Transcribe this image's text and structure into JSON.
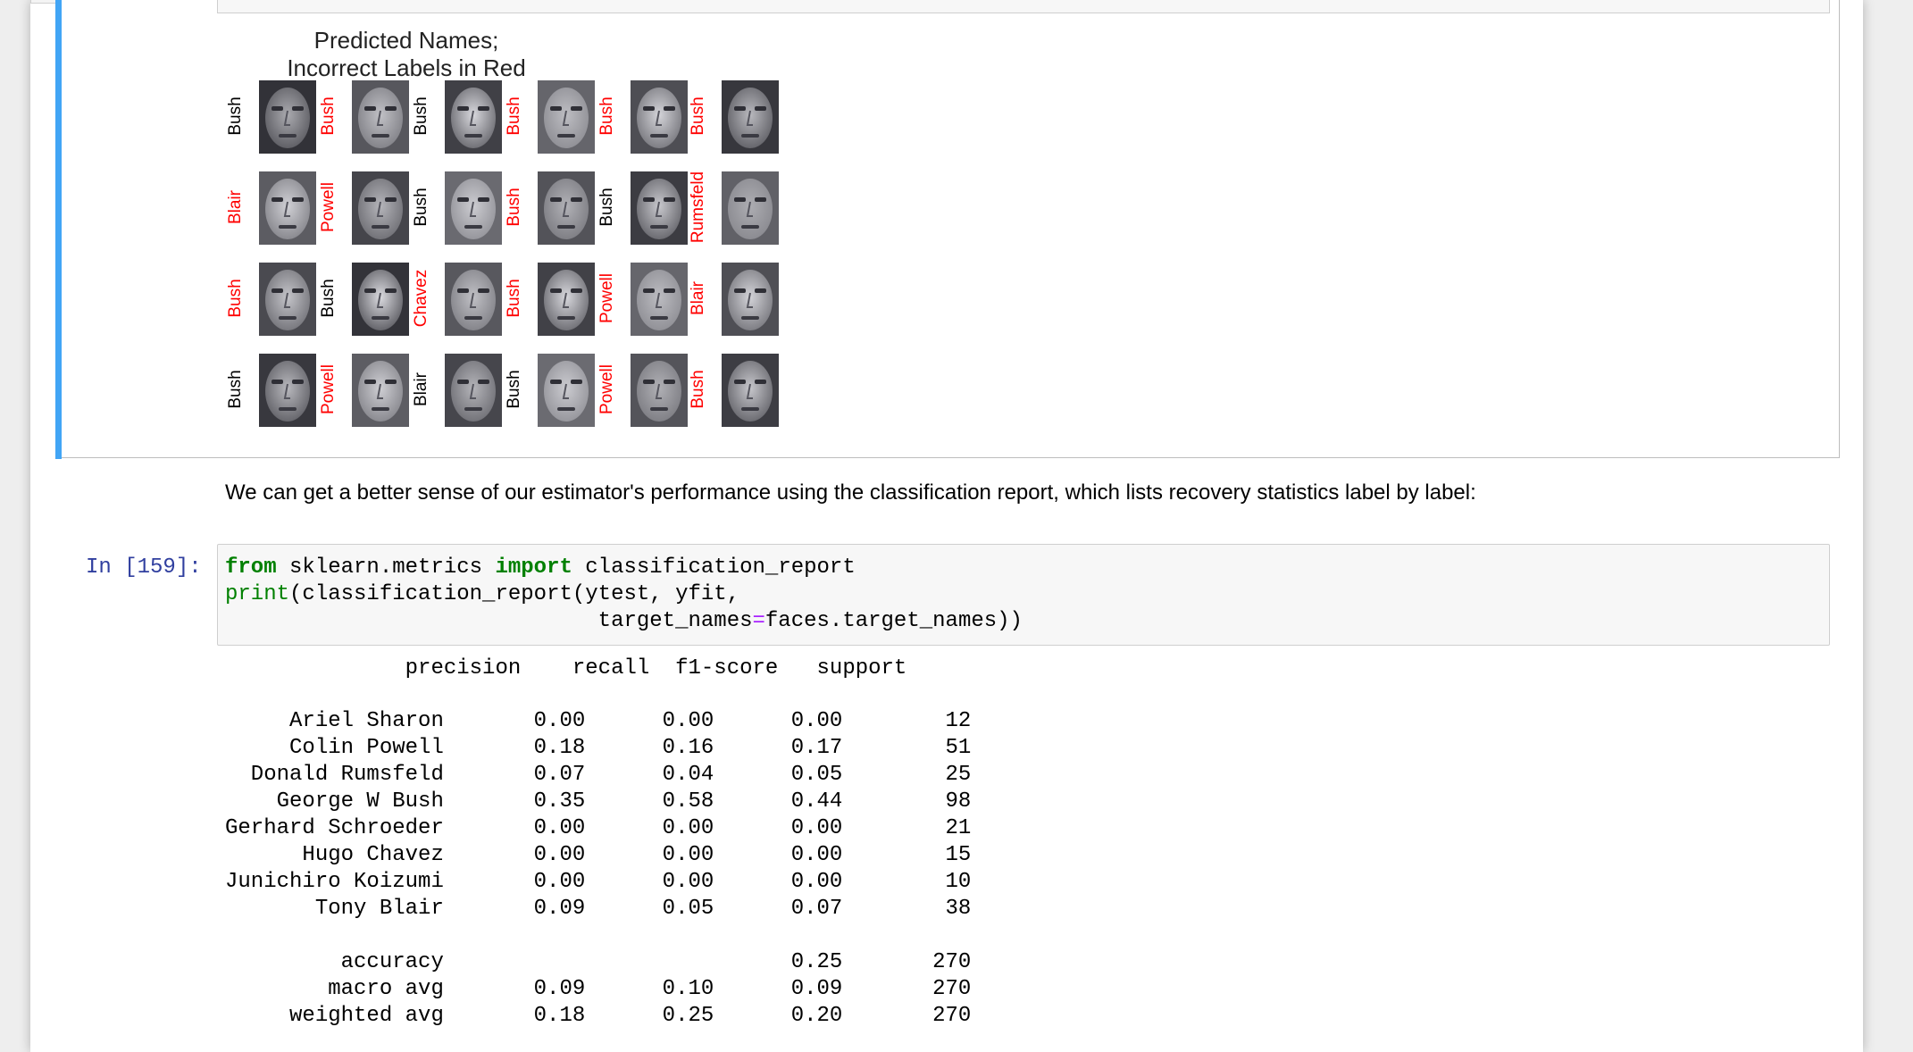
{
  "figure": {
    "title": "Predicted Names; Incorrect Labels in Red",
    "faces": [
      {
        "label": "Bush",
        "correct": true
      },
      {
        "label": "Bush",
        "correct": false
      },
      {
        "label": "Bush",
        "correct": true
      },
      {
        "label": "Bush",
        "correct": false
      },
      {
        "label": "Bush",
        "correct": false
      },
      {
        "label": "Bush",
        "correct": false
      },
      {
        "label": "Blair",
        "correct": false
      },
      {
        "label": "Powell",
        "correct": false
      },
      {
        "label": "Bush",
        "correct": true
      },
      {
        "label": "Bush",
        "correct": false
      },
      {
        "label": "Bush",
        "correct": true
      },
      {
        "label": "Rumsfeld",
        "correct": false
      },
      {
        "label": "Bush",
        "correct": false
      },
      {
        "label": "Bush",
        "correct": true
      },
      {
        "label": "Chavez",
        "correct": false
      },
      {
        "label": "Bush",
        "correct": false
      },
      {
        "label": "Powell",
        "correct": false
      },
      {
        "label": "Blair",
        "correct": false
      },
      {
        "label": "Bush",
        "correct": true
      },
      {
        "label": "Powell",
        "correct": false
      },
      {
        "label": "Blair",
        "correct": true
      },
      {
        "label": "Bush",
        "correct": true
      },
      {
        "label": "Powell",
        "correct": false
      },
      {
        "label": "Bush",
        "correct": false
      }
    ],
    "colors": {
      "correct": "#000000",
      "incorrect": "#ff0000"
    }
  },
  "markdown": {
    "text": "We can get a better sense of our estimator's performance using the classification report, which lists recovery statistics label by label:"
  },
  "code_cell": {
    "prompt": "In [159]:",
    "line1_kw1": "from",
    "line1_mid": " sklearn.metrics ",
    "line1_kw2": "import",
    "line1_end": " classification_report",
    "line2_fn": "print",
    "line2_rest": "(classification_report(ytest, yfit,",
    "line3_indent": "                             target_names",
    "line3_op": "=",
    "line3_end": "faces.target_names))"
  },
  "report": {
    "header": "              precision    recall  f1-score   support",
    "rows": [
      "     Ariel Sharon       0.00      0.00      0.00        12",
      "     Colin Powell       0.18      0.16      0.17        51",
      "  Donald Rumsfeld       0.07      0.04      0.05        25",
      "    George W Bush       0.35      0.58      0.44        98",
      "Gerhard Schroeder       0.00      0.00      0.00        21",
      "      Hugo Chavez       0.00      0.00      0.00        15",
      "Junichiro Koizumi       0.00      0.00      0.00        10",
      "       Tony Blair       0.09      0.05      0.07        38"
    ],
    "summary": [
      "         accuracy                           0.25       270",
      "        macro avg       0.09      0.10      0.09       270",
      "     weighted avg       0.18      0.25      0.20       270"
    ]
  }
}
